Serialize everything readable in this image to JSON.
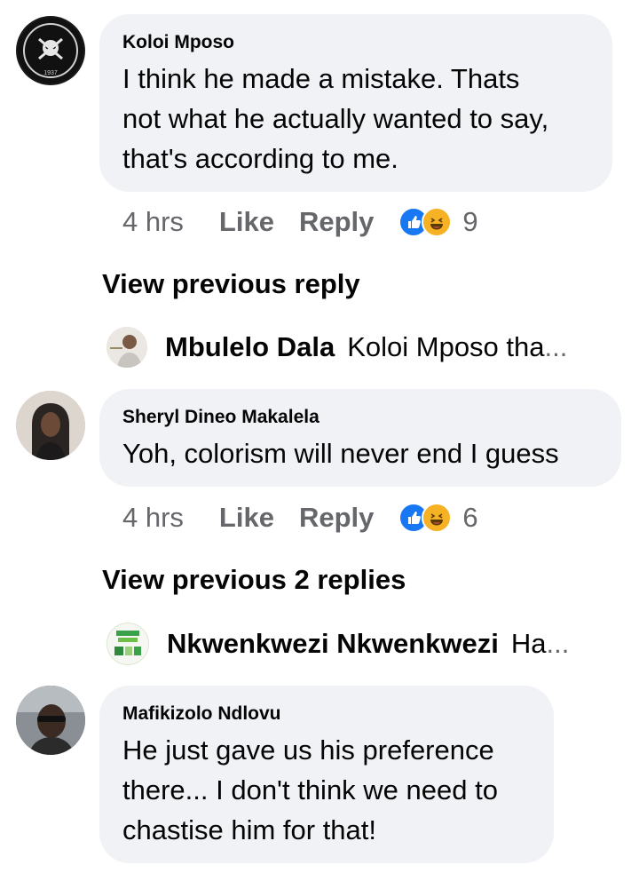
{
  "comments": [
    {
      "author": "Koloi Mposo",
      "lines": [
        "I think he made a mistake. Thats",
        "not what he actually wanted to say,",
        "that's according to me."
      ],
      "time": "4 hrs",
      "like": "Like",
      "reply": "Reply",
      "reactions": [
        "like-reaction-icon",
        "haha-reaction-icon"
      ],
      "reaction_count": "9",
      "view_previous": "View previous reply",
      "latest_reply": {
        "author": "Mbulelo Dala",
        "snippet": "Koloi Mposo tha",
        "ellipsis": "..."
      }
    },
    {
      "author": "Sheryl Dineo Makalela",
      "lines": [
        "Yoh, colorism will never end I guess"
      ],
      "time": "4 hrs",
      "like": "Like",
      "reply": "Reply",
      "reactions": [
        "like-reaction-icon",
        "haha-reaction-icon"
      ],
      "reaction_count": "6",
      "view_previous": "View previous 2 replies",
      "latest_reply": {
        "author": "Nkwenkwezi Nkwenkwezi",
        "snippet": "Ha",
        "ellipsis": "..."
      }
    },
    {
      "author": "Mafikizolo Ndlovu",
      "lines": [
        "He just gave us his preference",
        "there... I don't think we need to",
        "chastise him for that!"
      ]
    }
  ],
  "colors": {
    "bubble": "#f0f2f5",
    "meta_text": "#65676b",
    "like_blue": "#1877f2",
    "haha_yellow": "#f7b125"
  },
  "avatar_texts": {
    "club_year": "1937"
  }
}
